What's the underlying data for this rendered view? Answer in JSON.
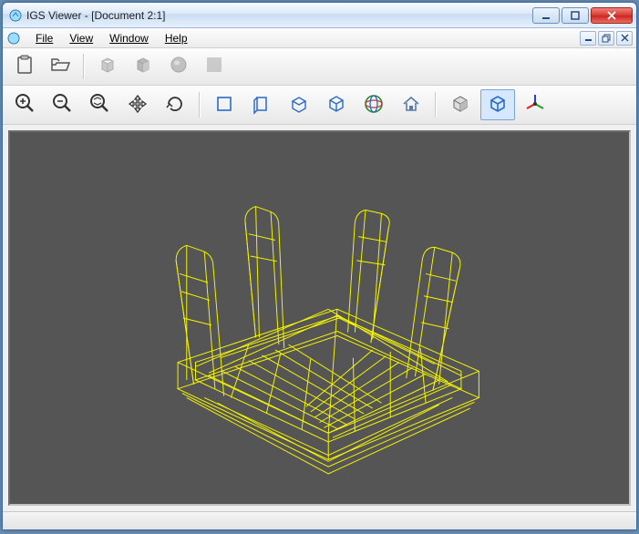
{
  "window": {
    "title": "IGS Viewer - [Document 2:1]"
  },
  "menu": {
    "file": "File",
    "view": "View",
    "window": "Window",
    "help": "Help"
  },
  "toolbar1": {
    "clipboard": "clipboard",
    "open": "open-folder",
    "shade_flat": "shade-flat",
    "shade_box": "shade-box",
    "shade_sphere": "shade-sphere",
    "shade_blank": "shade-blank"
  },
  "toolbar2": {
    "zoom_in": "zoom-in",
    "zoom_out": "zoom-out",
    "zoom_fit": "zoom-fit",
    "pan": "pan",
    "rotate": "rotate",
    "view_front": "view-front",
    "view_side": "view-side",
    "view_top": "view-top",
    "view_iso": "view-iso",
    "globe": "globe",
    "home": "home",
    "render_solid": "render-solid",
    "render_wire": "render-wire",
    "axes": "axes"
  },
  "viewport": {
    "background_color": "#555555",
    "wireframe_color": "#ffff00",
    "model_description": "3D wireframe of a shallow tray-like part with four upright posts at the corners, rendered in isometric view"
  }
}
